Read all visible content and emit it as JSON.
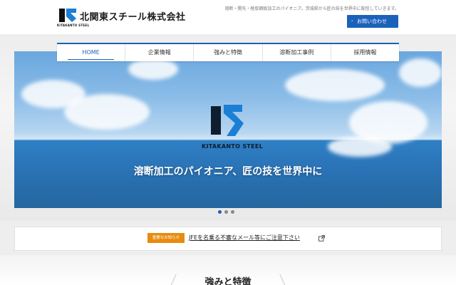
{
  "header": {
    "site_name": "北関東スチール株式会社",
    "logo_text": "KITAKANTO STEEL",
    "tagline": "溶断・開先・極厚鋼板加工のパイオニア。茨城県から匠の技を世界中に配信していきます。",
    "contact_label": "お問い合わせ"
  },
  "nav": {
    "items": [
      {
        "label": "HOME",
        "active": true
      },
      {
        "label": "企業情報",
        "active": false
      },
      {
        "label": "強みと特徴",
        "active": false
      },
      {
        "label": "溶断加工事例",
        "active": false
      },
      {
        "label": "採用情報",
        "active": false
      }
    ]
  },
  "hero": {
    "logo_text": "KITAKANTO STEEL",
    "caption": "溶断加工のパイオニア、匠の技を世界中に"
  },
  "carousel": {
    "slides": 3,
    "active": 1
  },
  "notice": {
    "badge": "重要なお知らせ",
    "link_text": "JFEを名乗る不審なメール等にご注意下さい"
  },
  "section": {
    "title": "強みと特徴"
  },
  "colors": {
    "brand_blue": "#1b62b9",
    "badge_orange": "#e88b0f",
    "logo_dark": "#111111",
    "logo_blue": "#1b7fd6"
  },
  "icons": {
    "chevron": "chevron-right-icon",
    "external": "external-link-icon"
  }
}
